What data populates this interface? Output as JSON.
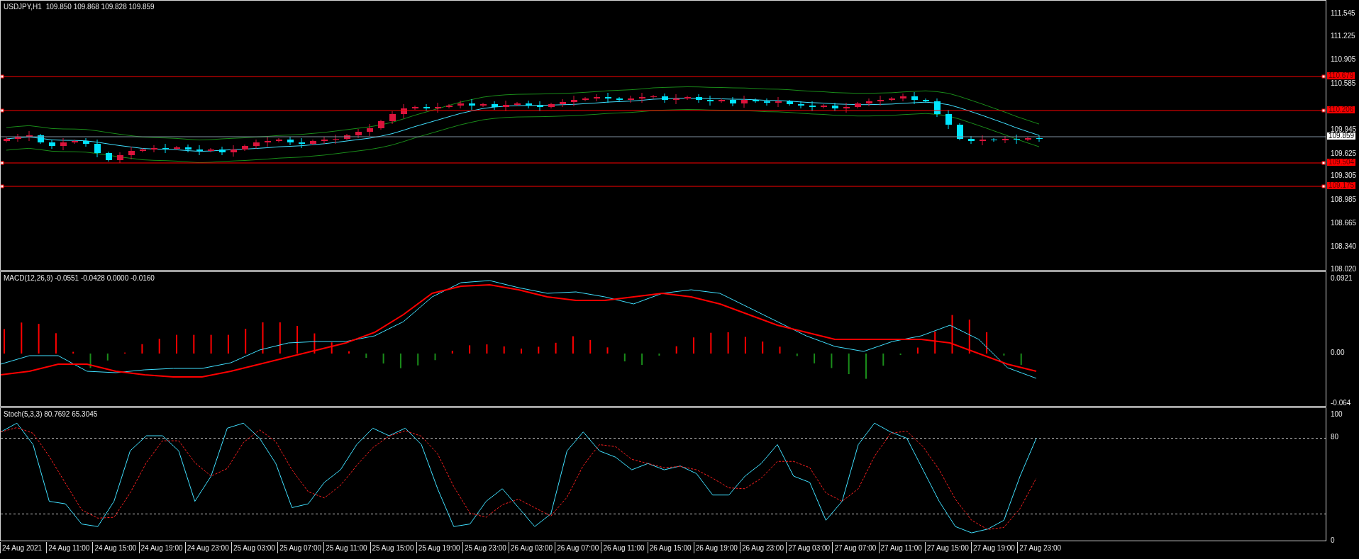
{
  "chart": {
    "title": "USDJPY,H1",
    "ohlc": [
      "109.850",
      "109.868",
      "109.828",
      "109.859"
    ]
  },
  "price_axis": {
    "ticks": [
      "111.545",
      "111.225",
      "110.905",
      "110.585",
      "109.945",
      "109.625",
      "109.305",
      "108.985",
      "108.665",
      "108.340",
      "108.020"
    ],
    "tags": [
      {
        "kind": "level",
        "value": "110.679"
      },
      {
        "kind": "level",
        "value": "110.206"
      },
      {
        "kind": "current",
        "value": "109.859"
      },
      {
        "kind": "level",
        "value": "109.504"
      },
      {
        "kind": "level",
        "value": "109.175"
      }
    ]
  },
  "macd": {
    "label": "MACD(12,26,9) -0.0551 -0.0428 0.0000 -0.0160",
    "axis": [
      "0.0921",
      "0.00",
      "-0.064"
    ]
  },
  "stochastic": {
    "label": "Stoch(5,3,3) 80.7692 65.3045",
    "axis": [
      "100",
      "80",
      "0"
    ]
  },
  "time_axis": [
    "24 Aug 2021",
    "24 Aug 11:00",
    "24 Aug 15:00",
    "24 Aug 19:00",
    "24 Aug 23:00",
    "25 Aug 03:00",
    "25 Aug 07:00",
    "25 Aug 11:00",
    "25 Aug 15:00",
    "25 Aug 19:00",
    "25 Aug 23:00",
    "26 Aug 03:00",
    "26 Aug 07:00",
    "26 Aug 11:00",
    "26 Aug 15:00",
    "26 Aug 19:00",
    "26 Aug 23:00",
    "27 Aug 03:00",
    "27 Aug 07:00",
    "27 Aug 11:00",
    "27 Aug 15:00",
    "27 Aug 19:00",
    "27 Aug 23:00"
  ]
}
